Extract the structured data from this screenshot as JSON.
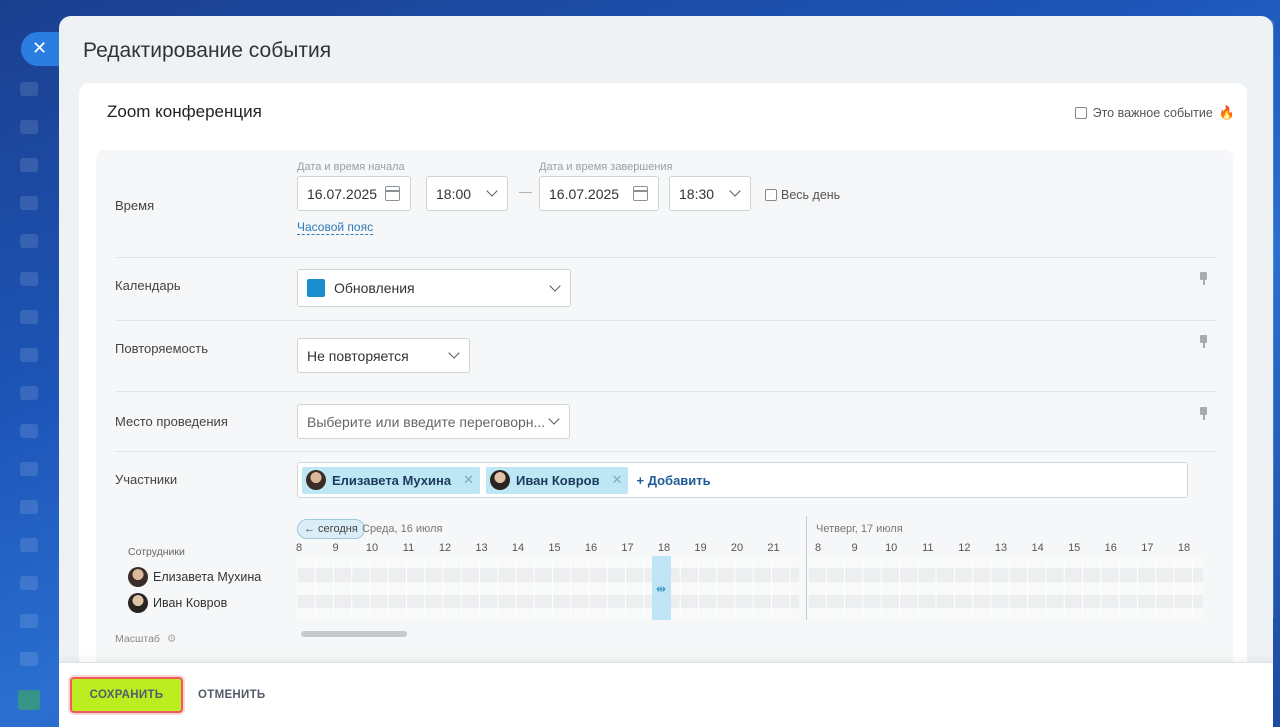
{
  "slider": {
    "title": "Редактирование события"
  },
  "event": {
    "name": "Zoom конференция",
    "important_label": "Это важное событие"
  },
  "time": {
    "label": "Время",
    "start_caption": "Дата и время начала",
    "start_date": "16.07.2025",
    "start_time": "18:00",
    "end_caption": "Дата и время завершения",
    "end_date": "16.07.2025",
    "end_time": "18:30",
    "dash": "—",
    "all_day_label": "Весь день",
    "timezone_link": "Часовой пояс"
  },
  "calendar": {
    "label": "Календарь",
    "value": "Обновления",
    "color": "#1a8fd0"
  },
  "repeat": {
    "label": "Повторяемость",
    "value": "Не повторяется"
  },
  "location": {
    "label": "Место проведения",
    "placeholder": "Выберите или введите переговорн..."
  },
  "attendees": {
    "label": "Участники",
    "chips": [
      {
        "name": "Елизавета Мухина"
      },
      {
        "name": "Иван Ковров"
      }
    ],
    "add_label": "+ Добавить"
  },
  "planner": {
    "today_button": "← сегодня",
    "day1_label": "Среда, 16 июля",
    "day2_label": "Четверг, 17 июля",
    "staff_title": "Сотрудники",
    "staff": [
      "Елизавета Мухина",
      "Иван Ковров"
    ],
    "scale_label": "Масштаб",
    "day1_hours": [
      "8",
      "9",
      "10",
      "11",
      "12",
      "13",
      "14",
      "15",
      "16",
      "17",
      "18",
      "19",
      "20",
      "21"
    ],
    "day2_hours": [
      "8",
      "9",
      "10",
      "11",
      "12",
      "13",
      "14",
      "15",
      "16",
      "17",
      "18"
    ]
  },
  "footer": {
    "save": "СОХРАНИТЬ",
    "cancel": "ОТМЕНИТЬ"
  },
  "colors": {
    "accent": "#bbed21",
    "highlight": "#f05a5a",
    "link": "#2f7ab8"
  }
}
